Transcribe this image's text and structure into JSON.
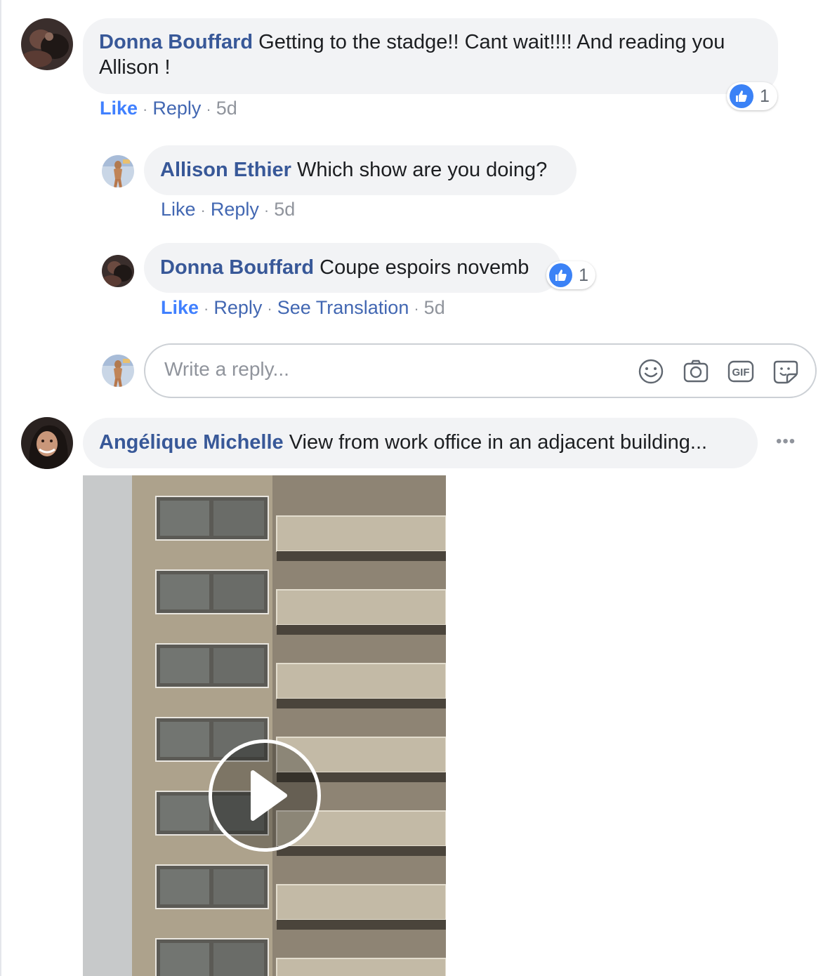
{
  "comments": [
    {
      "author": "Donna Bouffard",
      "text": "Getting to the stadge!! Cant wait!!!! And reading you",
      "text_cont": "Allison !",
      "like_label": "Like",
      "reply_label": "Reply",
      "time": "5d",
      "reaction_count": "1"
    },
    {
      "author": "Allison Ethier",
      "text": "Which show are you doing?",
      "like_label": "Like",
      "reply_label": "Reply",
      "time": "5d"
    },
    {
      "author": "Donna Bouffard",
      "text": "Coupe espoirs novemb",
      "like_label": "Like",
      "reply_label": "Reply",
      "translate_label": "See Translation",
      "time": "5d",
      "reaction_count": "1"
    }
  ],
  "reply_box": {
    "placeholder": "Write a reply...",
    "icons": [
      "emoji-icon",
      "camera-icon",
      "gif-icon",
      "sticker-icon"
    ],
    "gif_label": "GIF"
  },
  "post": {
    "author": "Angélique Michelle",
    "text": "View from work office in an adjacent building...",
    "more_label": "•••",
    "video_icon": "play-icon"
  },
  "colors": {
    "author": "#385898",
    "link": "#4267b2",
    "liked": "#4080ff",
    "bubble": "#f2f3f5",
    "meta": "#90949c",
    "reaction": "#3b82f6"
  }
}
